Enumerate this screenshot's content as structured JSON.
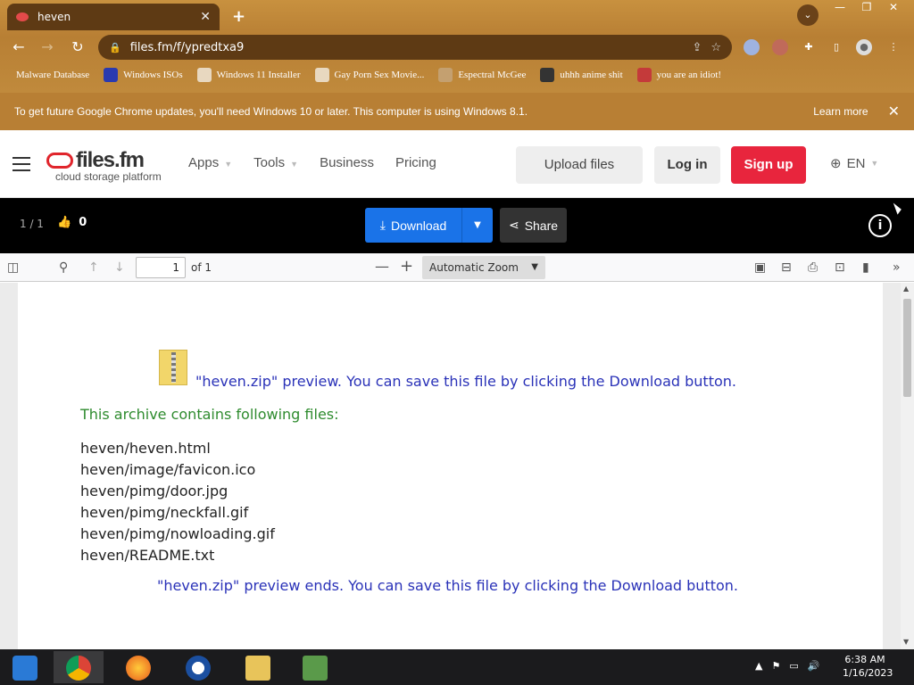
{
  "browser": {
    "tab_title": "heven",
    "url": "files.fm/f/ypredtxa9",
    "new_tab": "+",
    "tab_close": "✕",
    "bookmarks": [
      {
        "label": "Malware Database"
      },
      {
        "label": "Windows ISOs"
      },
      {
        "label": "Windows 11 Installer"
      },
      {
        "label": "Gay Porn Sex Movie..."
      },
      {
        "label": "Espectral McGee"
      },
      {
        "label": "uhhh anime shit"
      },
      {
        "label": "you are an idiot!"
      }
    ],
    "infobar": {
      "message": "To get future Google Chrome updates, you'll need Windows 10 or later. This computer is using Windows 8.1.",
      "learn_more": "Learn more"
    }
  },
  "site": {
    "logo_word": "files.fm",
    "logo_sub": "cloud storage platform",
    "nav": [
      {
        "label": "Apps",
        "has_caret": true
      },
      {
        "label": "Tools",
        "has_caret": true
      },
      {
        "label": "Business",
        "has_caret": false
      },
      {
        "label": "Pricing",
        "has_caret": false
      }
    ],
    "upload_files": "Upload files",
    "log_in": "Log in",
    "sign_up": "Sign up",
    "language": "EN"
  },
  "file_bar": {
    "pager": "1 / 1",
    "likes": "0",
    "download": "Download",
    "share": "Share"
  },
  "pdf_toolbar": {
    "page_value": "1",
    "page_of": "of 1",
    "zoom": "Automatic Zoom"
  },
  "document": {
    "preview_start": "\"heven.zip\" preview. You can save this file by clicking the Download button.",
    "contains": "This archive contains following files:",
    "files": [
      "heven/heven.html",
      "heven/image/favicon.ico",
      "heven/pimg/door.jpg",
      "heven/pimg/neckfall.gif",
      "heven/pimg/nowloading.gif",
      "heven/README.txt"
    ],
    "preview_end": "\"heven.zip\" preview ends. You can save this file by clicking the Download button."
  },
  "taskbar": {
    "time": "6:38 AM",
    "date": "1/16/2023"
  }
}
